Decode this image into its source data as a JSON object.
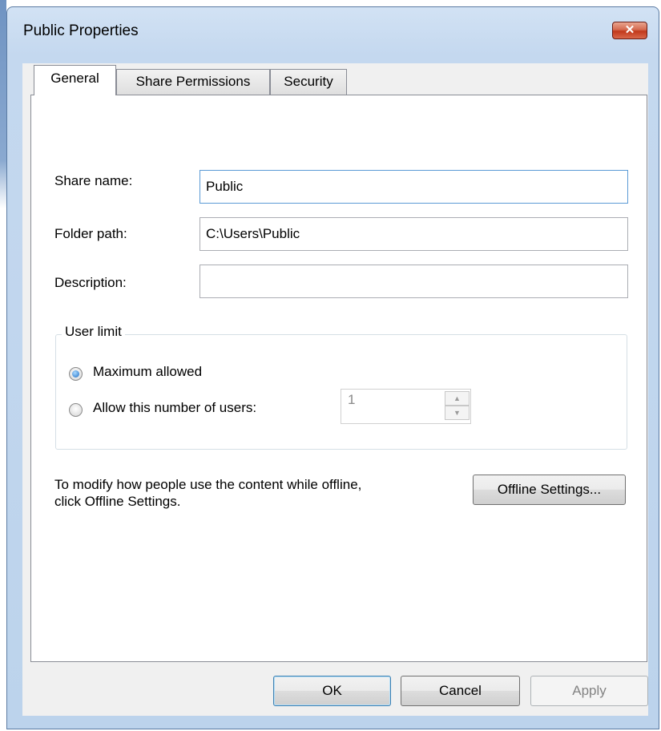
{
  "window": {
    "title": "Public Properties",
    "close_glyph": "✕"
  },
  "tabs": [
    {
      "label": "General",
      "active": true
    },
    {
      "label": "Share Permissions",
      "active": false
    },
    {
      "label": "Security",
      "active": false
    }
  ],
  "fields": {
    "share_name": {
      "label": "Share name:",
      "value": "Public"
    },
    "folder_path": {
      "label": "Folder path:",
      "value": "C:\\Users\\Public"
    },
    "description": {
      "label": "Description:",
      "value": ""
    }
  },
  "user_limit": {
    "title": "User limit",
    "option_max": "Maximum allowed",
    "option_number": "Allow this number of users:",
    "selected": "Maximum allowed",
    "number_value": "1"
  },
  "offline": {
    "text_line1": "To modify how people use the content while offline,",
    "text_line2": "click Offline Settings.",
    "button": "Offline Settings..."
  },
  "buttons": {
    "ok": "OK",
    "cancel": "Cancel",
    "apply": "Apply"
  },
  "colors": {
    "accent": "#3c7fb1",
    "close": "#c1381b",
    "radio_checked": "#1f6fc5"
  }
}
